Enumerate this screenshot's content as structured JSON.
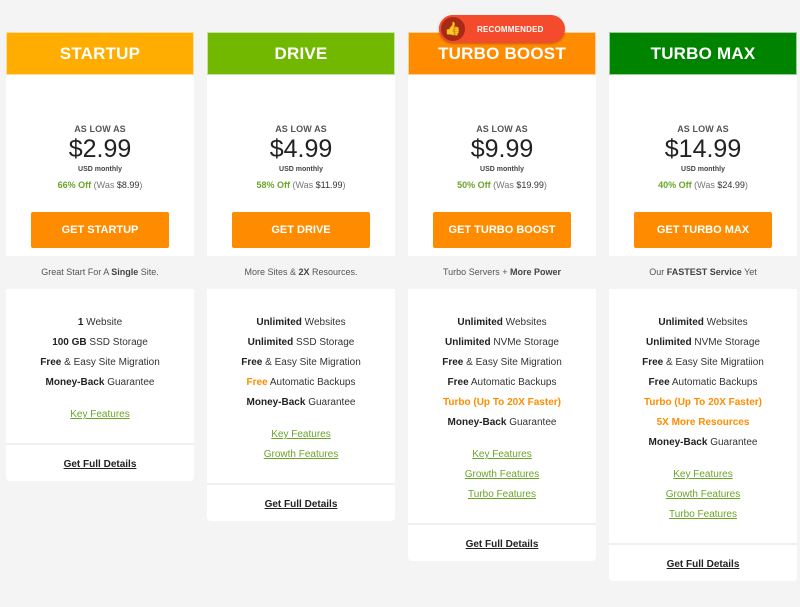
{
  "plans": [
    {
      "name": "STARTUP",
      "color": "#ffad00",
      "as_low_as": "AS LOW AS",
      "price": "$2.99",
      "period": "USD monthly",
      "discount": "66% Off",
      "was_label": "(Was",
      "was_amount": "$8.99",
      "was_close": ")",
      "button": "GET STARTUP",
      "tagline": {
        "pre": "Great Start For A ",
        "bold": "Single",
        "post": " Site."
      },
      "features": [
        {
          "bold": "1",
          "rest": " Website"
        },
        {
          "bold": "100 GB",
          "rest": " SSD Storage"
        },
        {
          "bold": "Free",
          "rest": " & Easy Site Migration"
        },
        {
          "bold": "Money-Back",
          "rest": " Guarantee"
        }
      ],
      "links": [
        "Key Features"
      ],
      "details": "Get Full Details"
    },
    {
      "name": "DRIVE",
      "color": "#72b800",
      "as_low_as": "AS LOW AS",
      "price": "$4.99",
      "period": "USD monthly",
      "discount": "58% Off",
      "was_label": "(Was",
      "was_amount": "$11.99",
      "was_close": ")",
      "button": "GET DRIVE",
      "tagline": {
        "pre": "More Sites & ",
        "bold": "2X",
        "post": " Resources."
      },
      "features": [
        {
          "bold": "Unlimited",
          "rest": " Websites"
        },
        {
          "bold": "Unlimited",
          "rest": " SSD Storage"
        },
        {
          "bold": "Free",
          "rest": " & Easy Site Migration"
        },
        {
          "orange": "Free",
          "rest": " Automatic Backups"
        },
        {
          "bold": "Money-Back",
          "rest": " Guarantee"
        }
      ],
      "links": [
        "Key Features",
        "Growth Features"
      ],
      "details": "Get Full Details"
    },
    {
      "name": "TURBO BOOST",
      "color": "#ff8c00",
      "badge": "RECOMMENDED",
      "as_low_as": "AS LOW AS",
      "price": "$9.99",
      "period": "USD monthly",
      "discount": "50% Off",
      "was_label": "(Was",
      "was_amount": "$19.99",
      "was_close": ")",
      "button": "GET TURBO BOOST",
      "tagline": {
        "pre": "Turbo Servers + ",
        "bold": "More Power",
        "post": ""
      },
      "features": [
        {
          "bold": "Unlimited",
          "rest": " Websites"
        },
        {
          "bold": "Unlimited",
          "rest": " NVMe Storage"
        },
        {
          "bold": "Free",
          "rest": " & Easy Site Migration"
        },
        {
          "bold": "Free",
          "rest": " Automatic Backups"
        },
        {
          "all_orange": "Turbo (Up To 20X Faster)"
        },
        {
          "bold": "Money-Back",
          "rest": " Guarantee"
        }
      ],
      "links": [
        "Key Features",
        "Growth Features",
        "Turbo Features"
      ],
      "details": "Get Full Details"
    },
    {
      "name": "TURBO MAX",
      "color": "#008400",
      "as_low_as": "AS LOW AS",
      "price": "$14.99",
      "period": "USD monthly",
      "discount": "40% Off",
      "was_label": "(Was",
      "was_amount": "$24.99",
      "was_close": ")",
      "button": "GET TURBO MAX",
      "tagline": {
        "pre": "Our ",
        "bold": "FASTEST Service",
        "post": " Yet"
      },
      "features": [
        {
          "bold": "Unlimited",
          "rest": " Websites"
        },
        {
          "bold": "Unlimited",
          "rest": " NVMe Storage"
        },
        {
          "bold": "Free",
          "rest": " & Easy Site Migratiion"
        },
        {
          "bold": "Free",
          "rest": " Automatic Backups"
        },
        {
          "all_orange": "Turbo (Up To 20X Faster)"
        },
        {
          "all_orange": "5X More Resources"
        },
        {
          "bold": "Money-Back",
          "rest": " Guarantee"
        }
      ],
      "links": [
        "Key Features",
        "Growth Features",
        "Turbo Features"
      ],
      "details": "Get Full Details"
    }
  ],
  "icons": {
    "badge_icon": "thumbs-up-icon"
  }
}
